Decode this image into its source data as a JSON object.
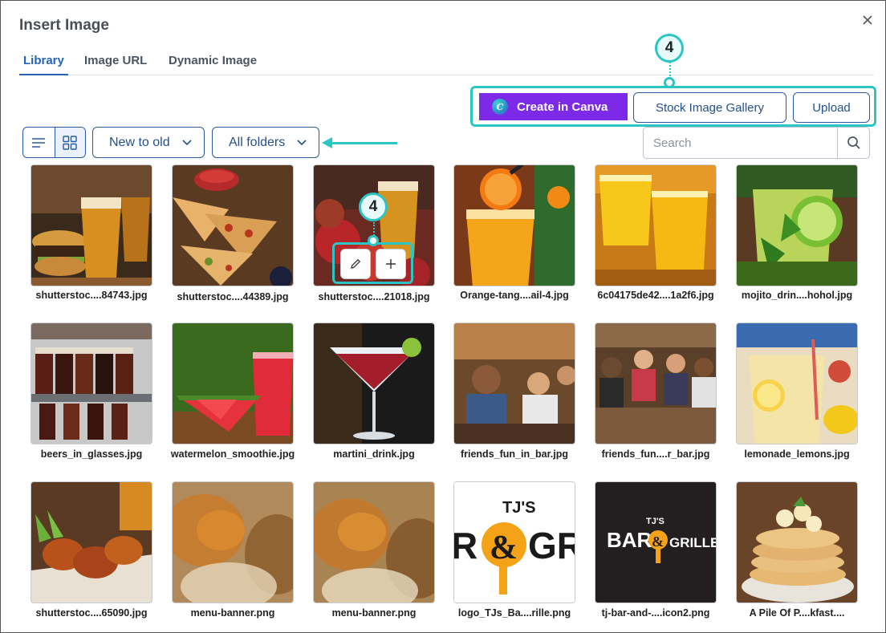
{
  "dialog": {
    "title": "Insert Image"
  },
  "tabs": [
    {
      "label": "Library",
      "active": true
    },
    {
      "label": "Image URL",
      "active": false
    },
    {
      "label": "Dynamic Image",
      "active": false
    }
  ],
  "actions": {
    "canva_label": "Create in Canva",
    "canva_logo_glyph": "C",
    "stock_label": "Stock Image Gallery",
    "upload_label": "Upload"
  },
  "callouts": {
    "top": "4",
    "tile": "4"
  },
  "toolbar": {
    "sort_label": "New to old",
    "folder_label": "All folders",
    "search_placeholder": "Search"
  },
  "images": [
    {
      "caption": "shutterstoc....84743.jpg"
    },
    {
      "caption": "shutterstoc....44389.jpg"
    },
    {
      "caption": "shutterstoc....21018.jpg"
    },
    {
      "caption": "Orange-tang....ail-4.jpg"
    },
    {
      "caption": "6c04175de42....1a2f6.jpg"
    },
    {
      "caption": "mojito_drin....hohol.jpg"
    },
    {
      "caption": "beers_in_glasses.jpg"
    },
    {
      "caption": "watermelon_smoothie.jpg"
    },
    {
      "caption": "martini_drink.jpg"
    },
    {
      "caption": "friends_fun_in_bar.jpg"
    },
    {
      "caption": "friends_fun....r_bar.jpg"
    },
    {
      "caption": "lemonade_lemons.jpg"
    },
    {
      "caption": "shutterstoc....65090.jpg"
    },
    {
      "caption": "menu-banner.png"
    },
    {
      "caption": "menu-banner.png"
    },
    {
      "caption": "logo_TJs_Ba....rille.png"
    },
    {
      "caption": "tj-bar-and-....icon2.png"
    },
    {
      "caption": "A Pile Of P....kfast...."
    }
  ],
  "logos": {
    "logo_light_small": "TJ'S",
    "logo_light_left": "R",
    "logo_light_amp": "&",
    "logo_light_right": "GRI",
    "logo_dark_small": "TJ'S",
    "logo_dark_left": "BAR",
    "logo_dark_amp": "&",
    "logo_dark_right": "GRILLE"
  },
  "icons": {
    "close": "close-icon",
    "list_view": "list-view-icon",
    "grid_view": "grid-view-icon",
    "chevron": "chevron-down-icon",
    "search": "search-icon",
    "edit": "pencil-icon",
    "add": "plus-icon"
  },
  "colors": {
    "accent": "#2763b4",
    "canva": "#7c2ae8",
    "callout": "#2cc5c5"
  }
}
